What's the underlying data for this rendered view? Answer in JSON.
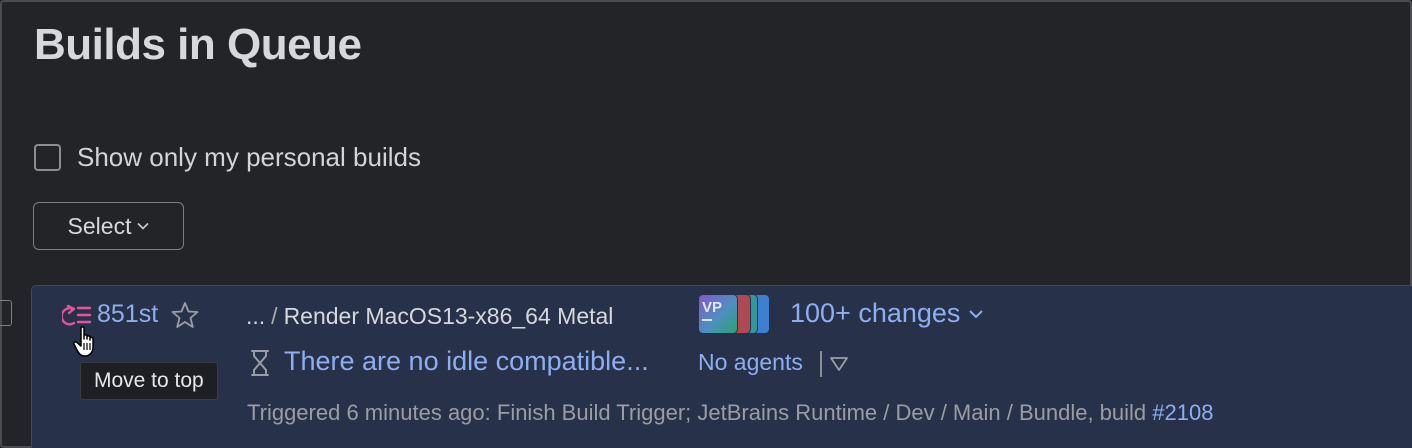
{
  "page": {
    "title": "Builds in Queue"
  },
  "filter": {
    "personal_label": "Show only my personal builds",
    "checked": false
  },
  "select_button": {
    "label": "Select"
  },
  "build": {
    "position": "851st",
    "path_ellipsis": "...",
    "path_separator": "/",
    "config_name": "Render MacOS13-x86_64 Metal",
    "wait_reason": "There are no idle compatible...",
    "changes": "100+ changes",
    "avatar_initials": "VP",
    "agents": "No agents",
    "trigger_text": "Triggered 6 minutes ago: Finish Build Trigger; JetBrains Runtime / Dev / Main / Bundle, build ",
    "trigger_build": "#2108"
  },
  "tooltip": {
    "text": "Move to top"
  },
  "colors": {
    "link": "#8eaef0",
    "move_icon": "#e0569b",
    "card_bg": "#27324a",
    "page_bg": "#232428"
  },
  "icons": {
    "move_top": "move-to-top-icon",
    "star": "star-icon",
    "hourglass": "hourglass-icon",
    "cursor": "hand-pointer-icon",
    "chevron": "chevron-down-icon",
    "agents_dropdown": "triangle-down-icon"
  }
}
